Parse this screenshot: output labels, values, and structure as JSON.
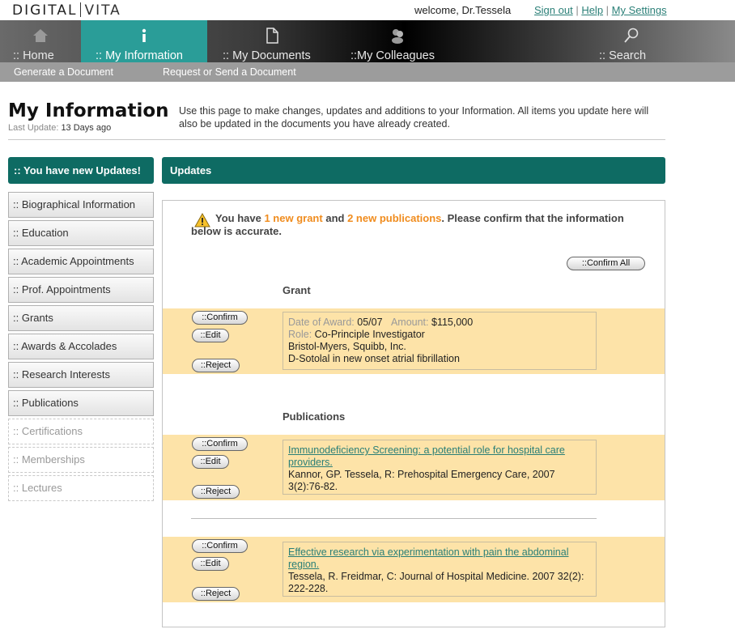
{
  "header": {
    "logo_left": "DIGITAL",
    "logo_right": "VITA",
    "welcome": "welcome, Dr.Tessela",
    "links": [
      "Sign out",
      "Help",
      "My Settings"
    ]
  },
  "nav": {
    "items": [
      {
        "label": ":: Home",
        "icon": "home-icon"
      },
      {
        "label": ":: My Information",
        "icon": "info-icon"
      },
      {
        "label": ":: My Documents",
        "icon": "document-icon"
      },
      {
        "label": "::My Colleagues",
        "icon": "colleagues-icon"
      },
      {
        "label": ":: Search",
        "icon": "search-icon"
      }
    ],
    "active_color": "#2a9d98"
  },
  "subnav": {
    "items": [
      "Generate a Document",
      "Request or Send a Document"
    ]
  },
  "page": {
    "title": "My Information",
    "last_update_label": "Last Update:",
    "last_update_value": "13 Days ago",
    "intro": "Use this page to make changes, updates and additions to your Information. All items you update here will also be updated in the documents you have already created."
  },
  "sidebar": {
    "new_updates": ":: You have new Updates!",
    "items": [
      {
        "label": ":: Biographical Information",
        "enabled": true
      },
      {
        "label": ":: Education",
        "enabled": true
      },
      {
        "label": ":: Academic Appointments",
        "enabled": true
      },
      {
        "label": ":: Prof. Appointments",
        "enabled": true
      },
      {
        "label": ":: Grants",
        "enabled": true
      },
      {
        "label": ":: Awards & Accolades",
        "enabled": true
      },
      {
        "label": ":: Research Interests",
        "enabled": true
      },
      {
        "label": ":: Publications",
        "enabled": true
      },
      {
        "label": ":: Certifications",
        "enabled": false
      },
      {
        "label": ":: Memberships",
        "enabled": false
      },
      {
        "label": ":: Lectures",
        "enabled": false
      }
    ]
  },
  "updates": {
    "title": "Updates",
    "warning_pre": "You have",
    "warning_hl1": "1 new grant",
    "warning_mid": "and",
    "warning_hl2": "2 new publications",
    "warning_post": ". Please confirm that the information below is accurate.",
    "confirm_all": "::Confirm All",
    "grant_heading": "Grant",
    "publications_heading": "Publications",
    "buttons": {
      "confirm": "::Confirm",
      "edit": "::Edit",
      "reject": "::Reject"
    },
    "grant": {
      "date_label": "Date of Award:",
      "date_value": "05/07",
      "amount_label": "Amount:",
      "amount_value": "$115,000",
      "role_label": "Role:",
      "role_value": "Co-Principle Investigator",
      "sponsor": "Bristol-Myers, Squibb, Inc.",
      "title": "D-Sotolal in new onset atrial fibrillation"
    },
    "publications": [
      {
        "title": "Immunodeficiency Screening: a potential role for hospital care providers.",
        "citation": "Kannor, GP. Tessela, R: Prehospital Emergency Care, 2007 3(2):76-82."
      },
      {
        "title": "Effective research via experimentation with pain the abdominal region.",
        "citation": "Tessela, R. Freidmar, C: Journal of Hospital Medicine. 2007 32(2): 222-228."
      }
    ],
    "band_color": "#fde3a8",
    "highlight_color": "#f08c1e"
  }
}
